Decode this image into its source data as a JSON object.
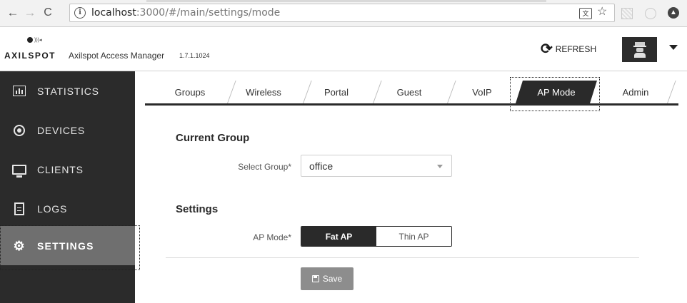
{
  "browser": {
    "back_glyph": "←",
    "forward_glyph": "→",
    "reload_glyph": "C",
    "url_host": "localhost",
    "url_path": ":3000/#/main/settings/mode",
    "icons": [
      "back-arrow-icon",
      "forward-arrow-icon",
      "reload-icon",
      "info-icon",
      "translate-icon",
      "star-icon",
      "extension-icon"
    ]
  },
  "header": {
    "brand": "AXILSPOT",
    "app_name": "Axilspot Access Manager",
    "version": "1.7.1.1024",
    "refresh_label": "REFRESH",
    "avatar_icon": "spy-avatar-icon"
  },
  "sidebar": {
    "items": [
      {
        "label": "STATISTICS",
        "icon": "bar-chart-icon"
      },
      {
        "label": "DEVICES",
        "icon": "target-icon"
      },
      {
        "label": "CLIENTS",
        "icon": "monitor-icon"
      },
      {
        "label": "LOGS",
        "icon": "document-icon"
      },
      {
        "label": "SETTINGS",
        "icon": "gear-icon"
      }
    ],
    "active": "SETTINGS"
  },
  "tabs": {
    "items": [
      "Groups",
      "Wireless",
      "Portal",
      "Guest",
      "VoIP",
      "AP Mode",
      "Admin"
    ],
    "active": "AP Mode"
  },
  "main": {
    "current_group_title": "Current Group",
    "select_group_label": "Select Group*",
    "select_group_value": "office",
    "settings_title": "Settings",
    "ap_mode_label": "AP Mode*",
    "ap_mode_options": [
      "Fat AP",
      "Thin AP"
    ],
    "ap_mode_selected": "Fat AP",
    "save_label": "Save"
  },
  "colors": {
    "sidebar_bg": "#2b2b2b",
    "sidebar_active_bg": "#6f6f6f",
    "accent_dark": "#2a2a2a",
    "save_button_bg": "#8d8d8d"
  }
}
